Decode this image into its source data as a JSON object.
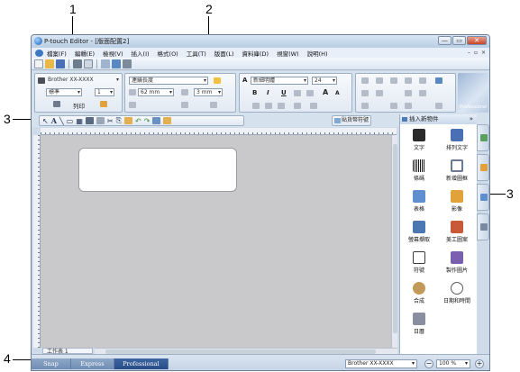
{
  "callouts": [
    "1",
    "2",
    "3",
    "3",
    "4"
  ],
  "window": {
    "title": "P-touch Editor - [版面配置2]",
    "controls": [
      "—",
      "▭",
      "✕"
    ]
  },
  "menu": {
    "items": [
      "檔案(F)",
      "編輯(E)",
      "檢視(V)",
      "插入(I)",
      "格式(O)",
      "工具(T)",
      "版面(L)",
      "資料庫(D)",
      "視窗(W)",
      "說明(H)"
    ],
    "right_controls": [
      "–",
      "▫",
      "×"
    ]
  },
  "print_panel": {
    "printer": "Brother XX-XXXX",
    "mode": "標準",
    "copies": "1",
    "print_label": "列印"
  },
  "paper_panel": {
    "format": "連續長度",
    "width": "62 mm",
    "length": "3 mm"
  },
  "text_panel": {
    "font": "新細明體",
    "size": "24",
    "bold": "B",
    "italic": "I",
    "underline": "U",
    "grow": "A",
    "shrink": "A"
  },
  "logo_text": "Professional",
  "draw_tools": [
    "↖",
    "A",
    "╲",
    "▭",
    "▦",
    "✂",
    "⎘",
    "↶",
    "↷"
  ],
  "insert_object_button": "貼貨幣符號",
  "side_panel": {
    "title": "插入新物件",
    "objects": [
      {
        "label": "文字",
        "color": "#2b2b2b"
      },
      {
        "label": "排列文字",
        "color": "#4a6fb5"
      },
      {
        "label": "條碼",
        "color": "#1a1a1a"
      },
      {
        "label": "新增圖框",
        "color": "#6a7a90"
      },
      {
        "label": "表格",
        "color": "#5f8fcf"
      },
      {
        "label": "影像",
        "color": "#e2a23a"
      },
      {
        "label": "螢幕擷取",
        "color": "#4b78b3"
      },
      {
        "label": "美工圖案",
        "color": "#c85a3a"
      },
      {
        "label": "符號",
        "color": "#3a3a3a"
      },
      {
        "label": "製作圖片",
        "color": "#7a5fb0"
      },
      {
        "label": "合成",
        "color": "#c49a5a"
      },
      {
        "label": "日期和時間",
        "color": "#5a5a5a"
      },
      {
        "label": "日曆",
        "color": "#8a8fa0"
      }
    ]
  },
  "sheet_tab": "工作表 1",
  "modes": {
    "snap": "Snap",
    "express": "Express",
    "professional": "Professional"
  },
  "status": {
    "printer": "Brother XX-XXXX",
    "zoom": "100 %"
  }
}
